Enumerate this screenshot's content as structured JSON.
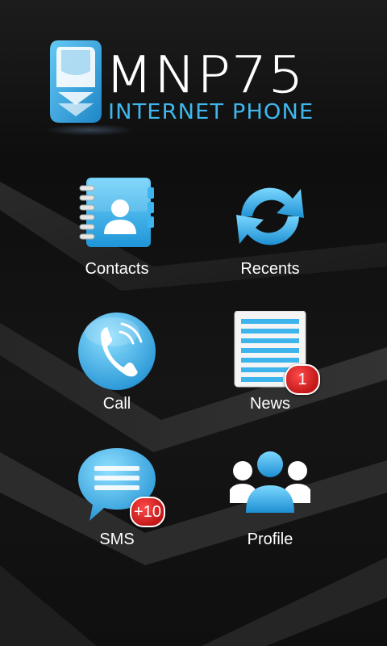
{
  "brand": {
    "name": "MNP75",
    "tagline": "INTERNET PHONE",
    "accent": "#3fb7ee"
  },
  "tiles": [
    {
      "label": "Contacts",
      "icon": "address-book-icon",
      "badge": ""
    },
    {
      "label": "Recents",
      "icon": "refresh-arrows-icon",
      "badge": ""
    },
    {
      "label": "Call",
      "icon": "phone-handset-icon",
      "badge": ""
    },
    {
      "label": "News",
      "icon": "news-document-icon",
      "badge": "1"
    },
    {
      "label": "SMS",
      "icon": "chat-bubble-icon",
      "badge": "+10"
    },
    {
      "label": "Profile",
      "icon": "people-group-icon",
      "badge": ""
    }
  ],
  "colors": {
    "icon_blue": "#3db4ec",
    "icon_light": "#8fdcff",
    "badge_red": "#d11f1f",
    "background": "#111111"
  }
}
